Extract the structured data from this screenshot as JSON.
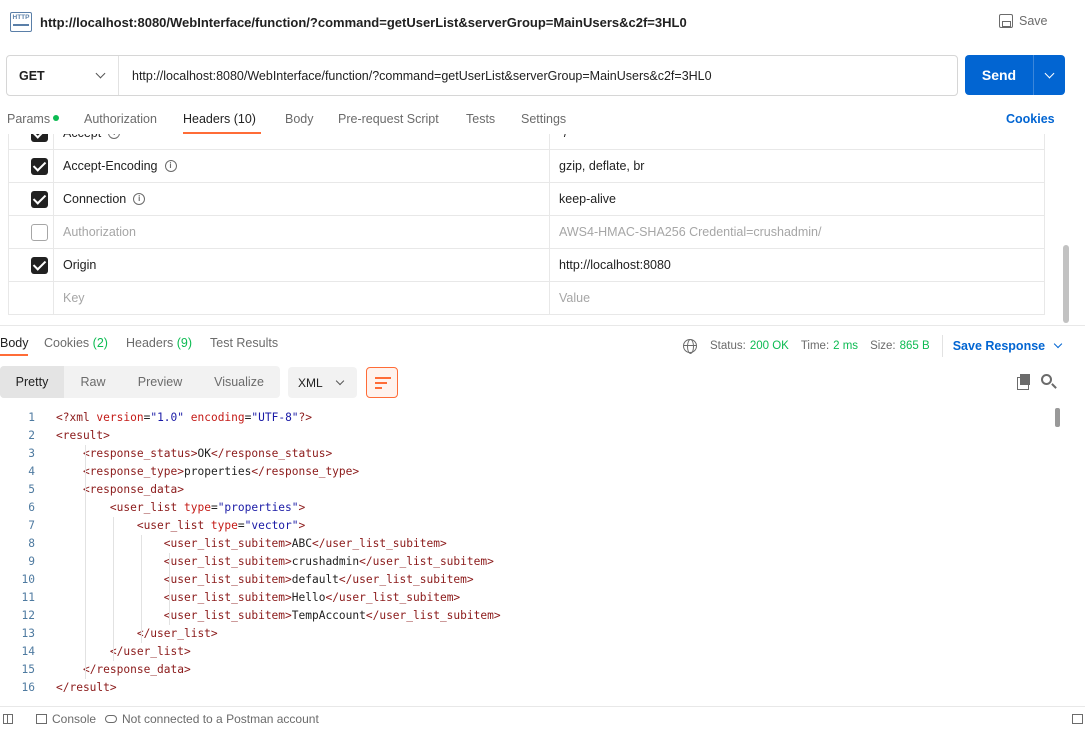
{
  "request": {
    "title": "http://localhost:8080/WebInterface/function/?command=getUserList&serverGroup=MainUsers&c2f=3HL0",
    "save_label": "Save",
    "method": "GET",
    "url": "http://localhost:8080/WebInterface/function/?command=getUserList&serverGroup=MainUsers&c2f=3HL0",
    "send_label": "Send"
  },
  "request_tabs": {
    "params": "Params",
    "authorization": "Authorization",
    "headers": "Headers",
    "headers_count": "(10)",
    "body": "Body",
    "prerequest": "Pre-request Script",
    "tests": "Tests",
    "settings": "Settings",
    "cookies": "Cookies"
  },
  "headers": [
    {
      "key": "Accept",
      "value": "*/*",
      "enabled": true,
      "info": true
    },
    {
      "key": "Accept-Encoding",
      "value": "gzip, deflate, br",
      "enabled": true,
      "info": true
    },
    {
      "key": "Connection",
      "value": "keep-alive",
      "enabled": true,
      "info": true
    },
    {
      "key": "Authorization",
      "value": "AWS4-HMAC-SHA256 Credential=crushadmin/",
      "enabled": false,
      "info": false
    },
    {
      "key": "Origin",
      "value": "http://localhost:8080",
      "enabled": true,
      "info": false
    }
  ],
  "headers_placeholder": {
    "key": "Key",
    "value": "Value"
  },
  "response_tabs": {
    "body": "Body",
    "cookies": "Cookies",
    "cookies_count": "(2)",
    "headers": "Headers",
    "headers_count": "(9)",
    "test_results": "Test Results"
  },
  "response_status": {
    "status_label": "Status:",
    "status_value": "200 OK",
    "time_label": "Time:",
    "time_value": "2 ms",
    "size_label": "Size:",
    "size_value": "865 B",
    "save_response": "Save Response"
  },
  "view_modes": [
    "Pretty",
    "Raw",
    "Preview",
    "Visualize"
  ],
  "format": "XML",
  "code_lines": [
    {
      "n": "1",
      "html": "<span class=\"tag\">&lt;?xml </span><span class=\"attr\">version</span><span class=\"txt\">=</span><span class=\"str\">\"1.0\"</span><span class=\"attr\"> encoding</span><span class=\"txt\">=</span><span class=\"str\">\"UTF-8\"</span><span class=\"tag\">?&gt;</span>"
    },
    {
      "n": "2",
      "html": "<span class=\"tag\">&lt;result&gt;</span>"
    },
    {
      "n": "3",
      "html": "    <span class=\"tag\">&lt;response_status&gt;</span><span class=\"txt\">OK</span><span class=\"tag\">&lt;/response_status&gt;</span>"
    },
    {
      "n": "4",
      "html": "    <span class=\"tag\">&lt;response_type&gt;</span><span class=\"txt\">properties</span><span class=\"tag\">&lt;/response_type&gt;</span>"
    },
    {
      "n": "5",
      "html": "    <span class=\"tag\">&lt;response_data&gt;</span>"
    },
    {
      "n": "6",
      "html": "        <span class=\"tag\">&lt;user_list </span><span class=\"attr\">type</span><span class=\"txt\">=</span><span class=\"str\">\"properties\"</span><span class=\"tag\">&gt;</span>"
    },
    {
      "n": "7",
      "html": "            <span class=\"tag\">&lt;user_list </span><span class=\"attr\">type</span><span class=\"txt\">=</span><span class=\"str\">\"vector\"</span><span class=\"tag\">&gt;</span>"
    },
    {
      "n": "8",
      "html": "                <span class=\"tag\">&lt;user_list_subitem&gt;</span><span class=\"txt\">ABC</span><span class=\"tag\">&lt;/user_list_subitem&gt;</span>"
    },
    {
      "n": "9",
      "html": "                <span class=\"tag\">&lt;user_list_subitem&gt;</span><span class=\"txt\">crushadmin</span><span class=\"tag\">&lt;/user_list_subitem&gt;</span>"
    },
    {
      "n": "10",
      "html": "                <span class=\"tag\">&lt;user_list_subitem&gt;</span><span class=\"txt\">default</span><span class=\"tag\">&lt;/user_list_subitem&gt;</span>"
    },
    {
      "n": "11",
      "html": "                <span class=\"tag\">&lt;user_list_subitem&gt;</span><span class=\"txt\">Hello</span><span class=\"tag\">&lt;/user_list_subitem&gt;</span>"
    },
    {
      "n": "12",
      "html": "                <span class=\"tag\">&lt;user_list_subitem&gt;</span><span class=\"txt\">TempAccount</span><span class=\"tag\">&lt;/user_list_subitem&gt;</span>"
    },
    {
      "n": "13",
      "html": "            <span class=\"tag\">&lt;/user_list&gt;</span>"
    },
    {
      "n": "14",
      "html": "        <span class=\"tag\">&lt;/user_list&gt;</span>"
    },
    {
      "n": "15",
      "html": "    <span class=\"tag\">&lt;/response_data&gt;</span>"
    },
    {
      "n": "16",
      "html": "<span class=\"tag\">&lt;/result&gt;</span>"
    }
  ],
  "bottom_bar": {
    "console": "Console",
    "account_status": "Not connected to a Postman account"
  },
  "colors": {
    "accent_blue": "#0265d2",
    "accent_orange": "#ff6c37",
    "success_green": "#0cbb52"
  }
}
